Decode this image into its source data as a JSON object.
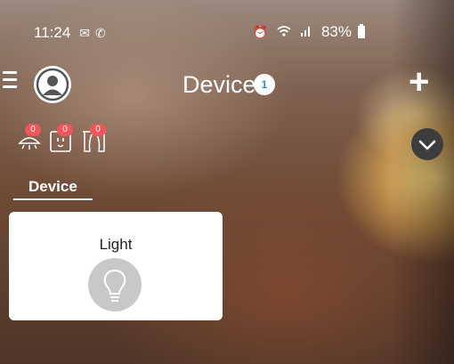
{
  "status_bar": {
    "time": "11:24",
    "left_icons": [
      "mail-icon",
      "phone-icon"
    ],
    "right_icons": [
      "alarm-icon",
      "wifi-icon",
      "signal-icon"
    ],
    "battery": "83%"
  },
  "header": {
    "title": "Device",
    "badge": "1",
    "icons": [
      "menu-icon",
      "avatar-icon",
      "plus-icon"
    ]
  },
  "categories": [
    {
      "name": "light",
      "icon": "light-icon",
      "count": "0"
    },
    {
      "name": "socket",
      "icon": "socket-icon",
      "count": "0"
    },
    {
      "name": "curtain",
      "icon": "curtain-icon",
      "count": "0"
    }
  ],
  "tab": {
    "label": "Device"
  },
  "devices": [
    {
      "label": "Light",
      "icon": "bulb-icon"
    }
  ],
  "colors": {
    "badge": "#f2555a",
    "card": "#ffffff",
    "icon_bg": "#c8c8c8",
    "chevron_bg": "#3d3d3d"
  }
}
